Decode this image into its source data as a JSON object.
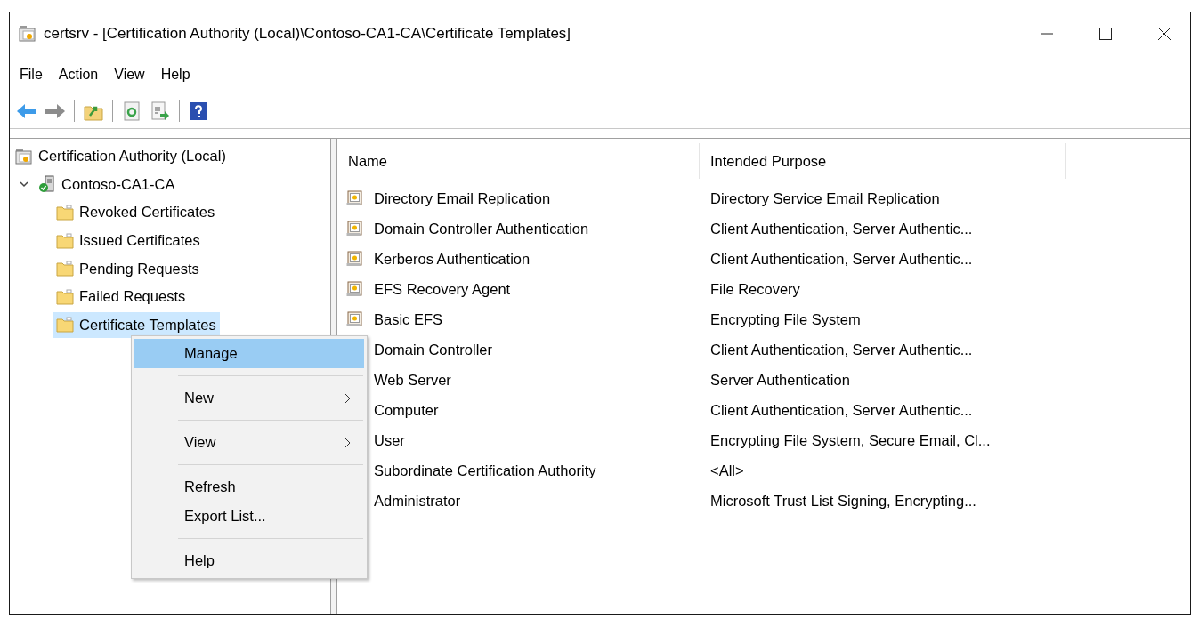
{
  "window": {
    "title": "certsrv - [Certification Authority (Local)\\Contoso-CA1-CA\\Certificate Templates]"
  },
  "menu_bar": [
    "File",
    "Action",
    "View",
    "Help"
  ],
  "toolbar": [
    {
      "kind": "back",
      "disabled": false
    },
    {
      "kind": "forward",
      "disabled": true
    },
    {
      "kind": "separator"
    },
    {
      "kind": "up"
    },
    {
      "kind": "separator"
    },
    {
      "kind": "refresh"
    },
    {
      "kind": "export"
    },
    {
      "kind": "separator"
    },
    {
      "kind": "help"
    }
  ],
  "tree": [
    {
      "label": "Certification Authority (Local)",
      "kind": "root",
      "selected": false,
      "children": [
        {
          "label": "Contoso-CA1-CA",
          "kind": "server",
          "selected": false,
          "expanded": true,
          "children": [
            {
              "label": "Revoked Certificates",
              "kind": "folder",
              "selected": false
            },
            {
              "label": "Issued Certificates",
              "kind": "folder",
              "selected": false
            },
            {
              "label": "Pending Requests",
              "kind": "folder",
              "selected": false
            },
            {
              "label": "Failed Requests",
              "kind": "folder",
              "selected": false
            },
            {
              "label": "Certificate Templates",
              "kind": "folder",
              "selected": true
            }
          ]
        }
      ]
    }
  ],
  "table": {
    "columns": [
      "Name",
      "Intended Purpose"
    ],
    "rows": [
      {
        "name": "Directory Email Replication",
        "purpose": "Directory Service Email Replication"
      },
      {
        "name": "Domain Controller Authentication",
        "purpose": "Client Authentication, Server Authentic..."
      },
      {
        "name": "Kerberos Authentication",
        "purpose": "Client Authentication, Server Authentic..."
      },
      {
        "name": "EFS Recovery Agent",
        "purpose": "File Recovery"
      },
      {
        "name": "Basic EFS",
        "purpose": "Encrypting File System"
      },
      {
        "name": "Domain Controller",
        "purpose": "Client Authentication, Server Authentic..."
      },
      {
        "name": "Web Server",
        "purpose": "Server Authentication"
      },
      {
        "name": "Computer",
        "purpose": "Client Authentication, Server Authentic..."
      },
      {
        "name": "User",
        "purpose": "Encrypting File System, Secure Email, Cl..."
      },
      {
        "name": "Subordinate Certification Authority",
        "purpose": "<All>"
      },
      {
        "name": "Administrator",
        "purpose": "Microsoft Trust List Signing, Encrypting..."
      }
    ]
  },
  "context_menu": {
    "groups": [
      [
        {
          "label": "Manage",
          "selected": true,
          "submenu": false
        }
      ],
      [
        {
          "label": "New",
          "selected": false,
          "submenu": true
        }
      ],
      [
        {
          "label": "View",
          "selected": false,
          "submenu": true
        }
      ],
      [
        {
          "label": "Refresh",
          "selected": false,
          "submenu": false
        },
        {
          "label": "Export List...",
          "selected": false,
          "submenu": false
        }
      ],
      [
        {
          "label": "Help",
          "selected": false,
          "submenu": false
        }
      ]
    ]
  }
}
